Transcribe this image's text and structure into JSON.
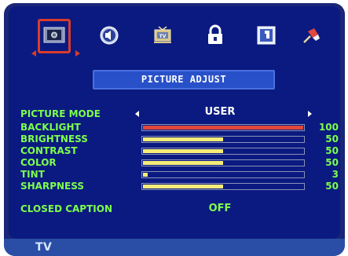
{
  "title": "PICTURE ADJUST",
  "icons": [
    "picture-icon",
    "audio-icon",
    "tv-icon",
    "lock-icon",
    "display-setup-icon",
    "tools-icon"
  ],
  "menu": {
    "picture_mode": {
      "label": "PICTURE MODE",
      "value": "USER"
    },
    "rows": [
      {
        "label": "BACKLIGHT",
        "value": "100",
        "level": 100
      },
      {
        "label": "BRIGHTNESS",
        "value": "50",
        "level": 50
      },
      {
        "label": "CONTRAST",
        "value": "50",
        "level": 50
      },
      {
        "label": "COLOR",
        "value": "50",
        "level": 50
      },
      {
        "label": "TINT",
        "value": "3",
        "level": 3
      },
      {
        "label": "SHARPNESS",
        "value": "50",
        "level": 50
      }
    ],
    "closed_caption": {
      "label": "CLOSED CAPTION",
      "value": "OFF"
    }
  },
  "footer": {
    "source": "TV"
  },
  "colors": {
    "label_green": "#7cff4c",
    "bar_yellow": "#f6ec78",
    "bar_red": "#e0483c",
    "panel_blue": "#0b1a80",
    "title_blue": "#2850c8",
    "selection_red": "#d83c2c"
  }
}
